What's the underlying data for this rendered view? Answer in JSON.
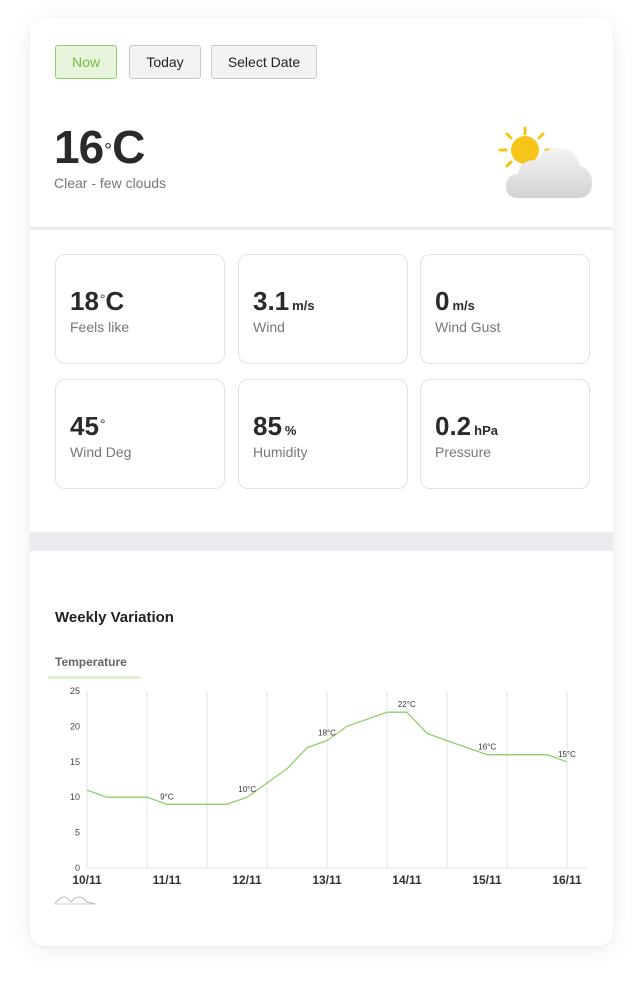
{
  "tabs": [
    {
      "label": "Now",
      "active": true
    },
    {
      "label": "Today",
      "active": false
    },
    {
      "label": "Select Date",
      "active": false
    }
  ],
  "current": {
    "temperature": "16",
    "unit": "C",
    "description": "Clear - few clouds",
    "icon": "sun-behind-cloud-icon"
  },
  "metrics": [
    {
      "value": "18",
      "unit": "C",
      "label": "Feels like",
      "type": "temp"
    },
    {
      "value": "3.1",
      "unit": "m/s",
      "label": "Wind",
      "type": "unit"
    },
    {
      "value": "0",
      "unit": "m/s",
      "label": "Wind Gust",
      "type": "unit"
    },
    {
      "value": "45",
      "unit": "°",
      "label": "Wind Deg",
      "type": "deg"
    },
    {
      "value": "85",
      "unit": "%",
      "label": "Humidity",
      "type": "unit"
    },
    {
      "value": "0.2",
      "unit": "hPa",
      "label": "Pressure",
      "type": "unit"
    }
  ],
  "weekly": {
    "title": "Weekly Variation",
    "tab": "Temperature"
  },
  "colors": {
    "accent": "#8fcf6a",
    "line": "#8fcf6a",
    "sun": "#f5c518"
  },
  "chart_data": {
    "type": "line",
    "title": "",
    "xlabel": "",
    "ylabel": "",
    "ylim": [
      0,
      25
    ],
    "yticks": [
      0,
      5,
      10,
      15,
      20,
      25
    ],
    "x_labels": [
      "10/11",
      "11/11",
      "12/11",
      "13/11",
      "14/11",
      "15/11",
      "16/11"
    ],
    "x_label_positions": [
      0,
      1.3333,
      2.6667,
      4,
      5.3333,
      6.6667,
      8
    ],
    "x_range": [
      0,
      8
    ],
    "series": [
      {
        "x": [
          0,
          0.33,
          1,
          1.33,
          2,
          2.33,
          2.67,
          3,
          3.33,
          3.67,
          4,
          4.33,
          5,
          5.33,
          5.67,
          6,
          6.67,
          7,
          7.67,
          8
        ],
        "values": [
          11,
          10,
          10,
          9,
          9,
          9,
          10,
          12,
          14,
          17,
          18,
          20,
          22,
          22,
          19,
          18,
          16,
          16,
          16,
          15
        ]
      }
    ],
    "annotations": [
      {
        "x": 1.33,
        "y": 9,
        "label": "9°C"
      },
      {
        "x": 2.67,
        "y": 10,
        "label": "10°C"
      },
      {
        "x": 4,
        "y": 18,
        "label": "18°C"
      },
      {
        "x": 5.33,
        "y": 22,
        "label": "22°C"
      },
      {
        "x": 6.67,
        "y": 16,
        "label": "16°C"
      },
      {
        "x": 8,
        "y": 15,
        "label": "15°C"
      }
    ],
    "grid": "vertical"
  }
}
